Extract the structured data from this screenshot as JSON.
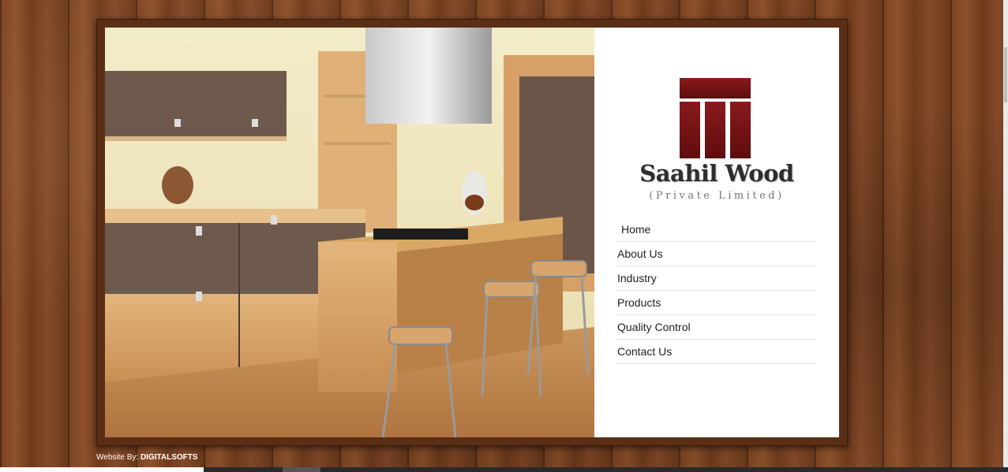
{
  "brand": {
    "name": "Saahil Wood",
    "subtitle": "(Private Limited)"
  },
  "nav": {
    "items": [
      {
        "label": "Home"
      },
      {
        "label": "About Us"
      },
      {
        "label": "Industry"
      },
      {
        "label": "Products"
      },
      {
        "label": "Quality Control"
      },
      {
        "label": "Contact Us"
      }
    ]
  },
  "footer": {
    "credit_prefix": "Website By: ",
    "credit_name": "DIGITALSOFTS"
  },
  "colors": {
    "logo": "#7a1416",
    "frame": "#5a2f16",
    "background_wood": "#7a4322"
  },
  "hero_image": {
    "description_icon": "kitchen-photo"
  }
}
